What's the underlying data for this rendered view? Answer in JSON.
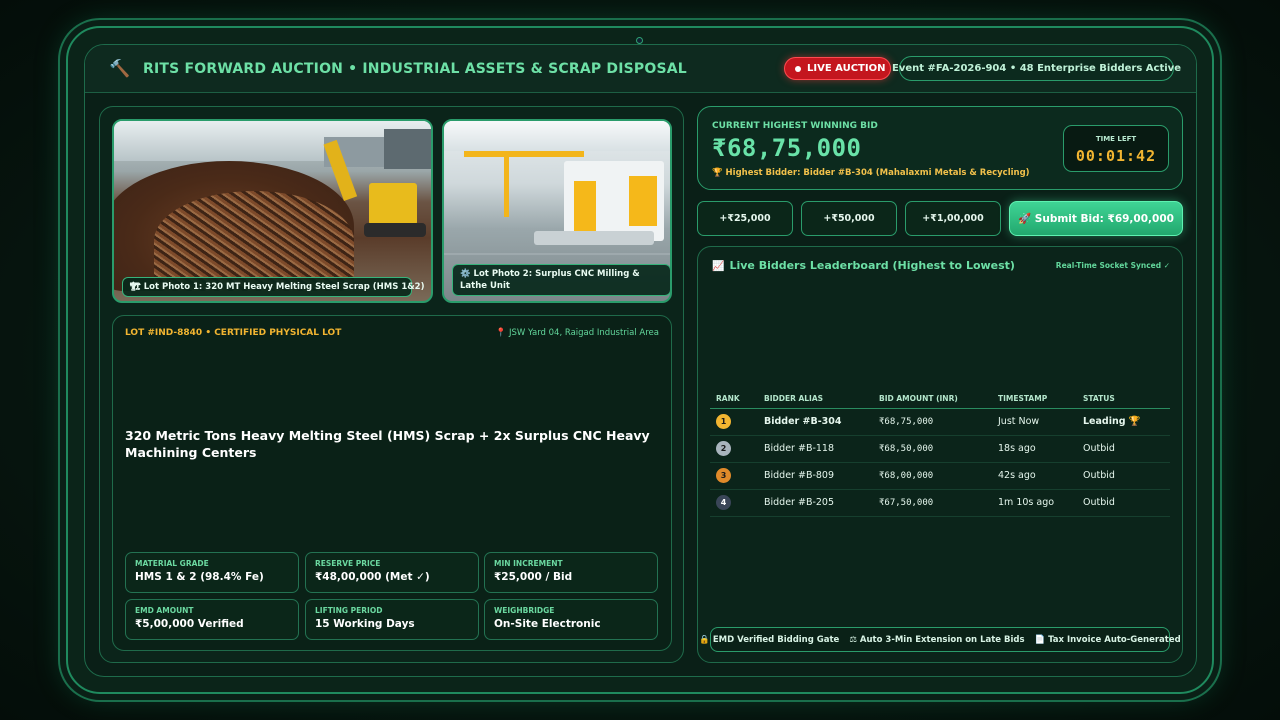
{
  "header": {
    "title": "RITS FORWARD AUCTION • INDUSTRIAL ASSETS & SCRAP DISPOSAL",
    "live_label": "LIVE AUCTION",
    "event_text": "Event #FA-2026-904 • 48 Enterprise Bidders Active",
    "icon": "hammer-icon"
  },
  "photos": [
    {
      "caption": "🏗 Lot Photo 1: 320 MT Heavy Melting Steel Scrap (HMS 1&2)"
    },
    {
      "caption": "⚙️ Lot Photo 2: Surplus CNC Milling & Lathe Unit"
    }
  ],
  "lot": {
    "id": "LOT #IND-8840 • CERTIFIED PHYSICAL LOT",
    "location": "JSW Yard 04, Raigad Industrial Area",
    "title": "320 Metric Tons Heavy Melting Steel (HMS) Scrap + 2x Surplus CNC Heavy Machining Centers",
    "specs": [
      {
        "label": "MATERIAL GRADE",
        "value": "HMS 1 & 2 (98.4% Fe)"
      },
      {
        "label": "RESERVE PRICE",
        "value": "₹48,00,000 (Met ✓)"
      },
      {
        "label": "MIN INCREMENT",
        "value": "₹25,000 / Bid"
      },
      {
        "label": "EMD AMOUNT",
        "value": "₹5,00,000 Verified"
      },
      {
        "label": "LIFTING PERIOD",
        "value": "15 Working Days"
      },
      {
        "label": "WEIGHBRIDGE",
        "value": "On-Site Electronic"
      }
    ]
  },
  "bid": {
    "label": "CURRENT HIGHEST WINNING BID",
    "amount": "₹68,75,000",
    "highest_bidder": "🏆 Highest Bidder: Bidder #B-304 (Mahalaxmi Metals & Recycling)",
    "time_label": "TIME LEFT",
    "time_value": "00:01:42"
  },
  "increments": [
    "+₹25,000",
    "+₹50,000",
    "+₹1,00,000"
  ],
  "submit_label": "🚀 Submit Bid: ₹69,00,000",
  "leaderboard": {
    "title": "Live Bidders Leaderboard (Highest to Lowest)",
    "sync_text": "Real-Time Socket Synced ✓",
    "columns": [
      "RANK",
      "BIDDER ALIAS",
      "BID AMOUNT (INR)",
      "TIMESTAMP",
      "STATUS"
    ],
    "rows": [
      {
        "rank": "1",
        "alias": "Bidder #B-304",
        "amount": "₹68,75,000",
        "time": "Just Now",
        "status": "Leading 🏆"
      },
      {
        "rank": "2",
        "alias": "Bidder #B-118",
        "amount": "₹68,50,000",
        "time": "18s ago",
        "status": "Outbid"
      },
      {
        "rank": "3",
        "alias": "Bidder #B-809",
        "amount": "₹68,00,000",
        "time": "42s ago",
        "status": "Outbid"
      },
      {
        "rank": "4",
        "alias": "Bidder #B-205",
        "amount": "₹67,50,000",
        "time": "1m 10s ago",
        "status": "Outbid"
      }
    ],
    "rank_colors": [
      "#f2b531",
      "#a9b4bd",
      "#e08a2a",
      "#3a4658"
    ],
    "footer": [
      "🔒 EMD Verified Bidding Gate",
      "⚖ Auto 3-Min Extension on Late Bids",
      "📄 Tax Invoice Auto-Generated"
    ]
  }
}
